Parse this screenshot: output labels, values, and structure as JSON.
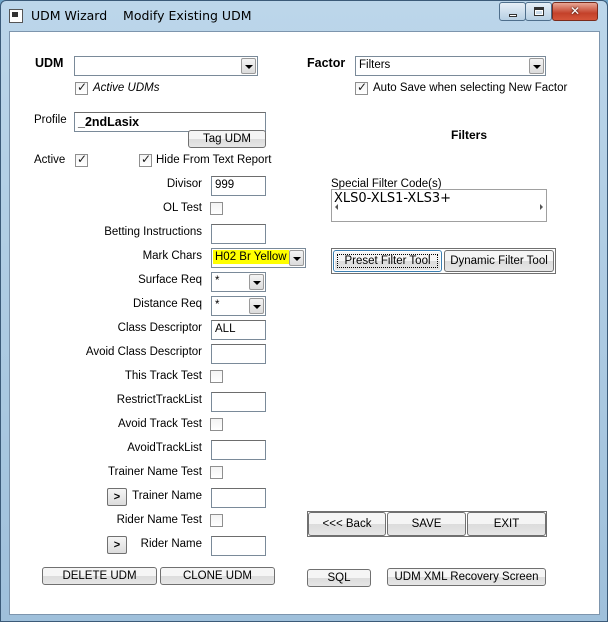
{
  "window": {
    "title": "UDM Wizard    Modify Existing UDM"
  },
  "udm": {
    "label": "UDM",
    "value": "",
    "active_udms_label": "Active UDMs",
    "active_udms_checked": true
  },
  "factor": {
    "label": "Factor",
    "value": "Filters",
    "auto_save_label": "Auto Save when selecting New Factor",
    "auto_save_checked": true
  },
  "profile": {
    "label": "Profile",
    "value": "_2ndLasix",
    "tag_button": "Tag UDM"
  },
  "active": {
    "label": "Active",
    "checked": true,
    "hide_label": "Hide From Text Report",
    "hide_checked": true
  },
  "fields": {
    "divisor_label": "Divisor",
    "divisor_value": "999",
    "ol_test_label": "OL Test",
    "betting_label": "Betting Instructions",
    "betting_value": "",
    "mark_chars_label": "Mark Chars",
    "mark_chars_value": "H02 Br Yellow",
    "mark_chars_color": "#ffff00",
    "surface_label": "Surface Req",
    "surface_value": "*",
    "distance_label": "Distance Req",
    "distance_value": "*",
    "class_desc_label": "Class Descriptor",
    "class_desc_value": "ALL",
    "avoid_class_label": "Avoid Class Descriptor",
    "avoid_class_value": "",
    "this_track_label": "This Track Test",
    "restrict_track_label": "RestrictTrackList",
    "restrict_track_value": "",
    "avoid_track_test_label": "Avoid Track Test",
    "avoid_track_list_label": "AvoidTrackList",
    "avoid_track_list_value": "",
    "trainer_test_label": "Trainer Name Test",
    "trainer_name_label": "Trainer Name",
    "trainer_name_value": "",
    "rider_test_label": "Rider Name Test",
    "rider_name_label": "Rider Name",
    "rider_name_value": "",
    "expand_glyph": ">"
  },
  "filters": {
    "heading": "Filters",
    "special_code_label": "Special Filter Code(s)",
    "special_code_value": "XLS0-XLS1-XLS3+",
    "preset_button": "Preset Filter Tool",
    "dynamic_button": "Dynamic Filter Tool"
  },
  "nav": {
    "back": "<<< Back",
    "save": "SAVE",
    "exit": "EXIT"
  },
  "bottom": {
    "delete": "DELETE UDM",
    "clone": "CLONE UDM",
    "sql": "SQL",
    "xml_recovery": "UDM XML Recovery Screen"
  }
}
